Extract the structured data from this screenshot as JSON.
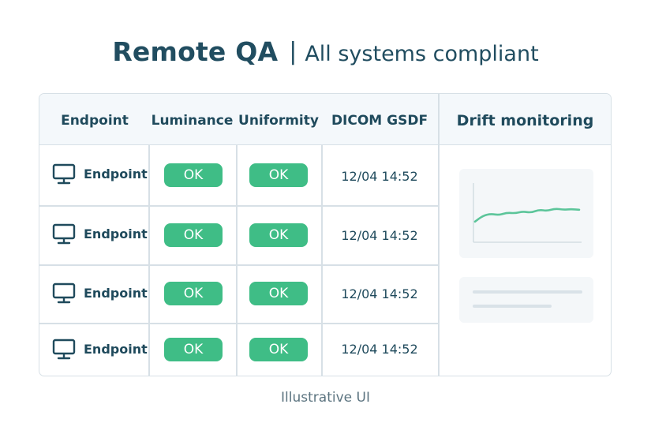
{
  "header": {
    "title": "Remote QA",
    "separator": "|",
    "subtitle": "All systems compliant"
  },
  "table": {
    "columns": [
      "Endpoint",
      "Luminance",
      "Uniformity",
      "DICOM GSDF"
    ],
    "rows": [
      {
        "endpoint": "Endpoint",
        "icon": "monitor-icon",
        "luminance": "OK",
        "uniformity": "OK",
        "gsdf": "12/04 14:52"
      },
      {
        "endpoint": "Endpoint",
        "icon": "monitor-icon",
        "luminance": "OK",
        "uniformity": "OK",
        "gsdf": "12/04 14:52"
      },
      {
        "endpoint": "Endpoint",
        "icon": "monitor-icon",
        "luminance": "OK",
        "uniformity": "OK",
        "gsdf": "12/04 14:52"
      },
      {
        "endpoint": "Endpoint",
        "icon": "monitor-icon",
        "luminance": "OK",
        "uniformity": "OK",
        "gsdf": "12/04 14:52"
      }
    ]
  },
  "drift": {
    "title": "Drift monitoring",
    "sparkline": {
      "type": "line",
      "values": [
        0.35,
        0.45,
        0.48,
        0.46,
        0.5,
        0.49,
        0.52,
        0.5,
        0.55,
        0.53,
        0.57,
        0.55,
        0.56,
        0.55
      ]
    }
  },
  "colors": {
    "ok_badge": "#3fbd86",
    "line": "#5cc59a",
    "text": "#1f4a5c",
    "border": "#d7e0e6"
  },
  "footer": {
    "caption": "Illustrative UI"
  }
}
